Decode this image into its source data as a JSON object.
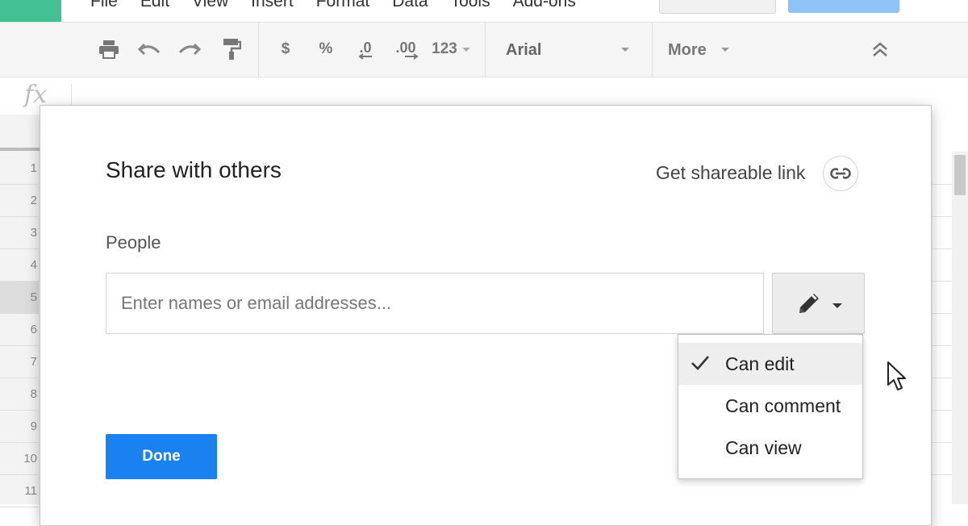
{
  "menubar": {
    "items": [
      "File",
      "Edit",
      "View",
      "Insert",
      "Format",
      "Data",
      "Tools",
      "Add-ons"
    ]
  },
  "toolbar": {
    "currency_label": "$",
    "percent_label": "%",
    "decrease_decimal_label": ".0",
    "increase_decimal_label": ".00",
    "number_format_label": "123",
    "font_name": "Arial",
    "more_label": "More"
  },
  "formula_bar": {
    "fx_label": "fx"
  },
  "grid": {
    "row_numbers": [
      "1",
      "2",
      "3",
      "4",
      "5",
      "6",
      "7",
      "8",
      "9",
      "10",
      "11"
    ],
    "selected_row": "5"
  },
  "dialog": {
    "title": "Share with others",
    "get_link_label": "Get shareable link",
    "people_label": "People",
    "people_placeholder": "Enter names or email addresses...",
    "permission_options": [
      "Can edit",
      "Can comment",
      "Can view"
    ],
    "selected_permission": "Can edit",
    "done_label": "Done"
  },
  "colors": {
    "accent_blue": "#1a82f0",
    "app_badge_green": "#44c193"
  }
}
